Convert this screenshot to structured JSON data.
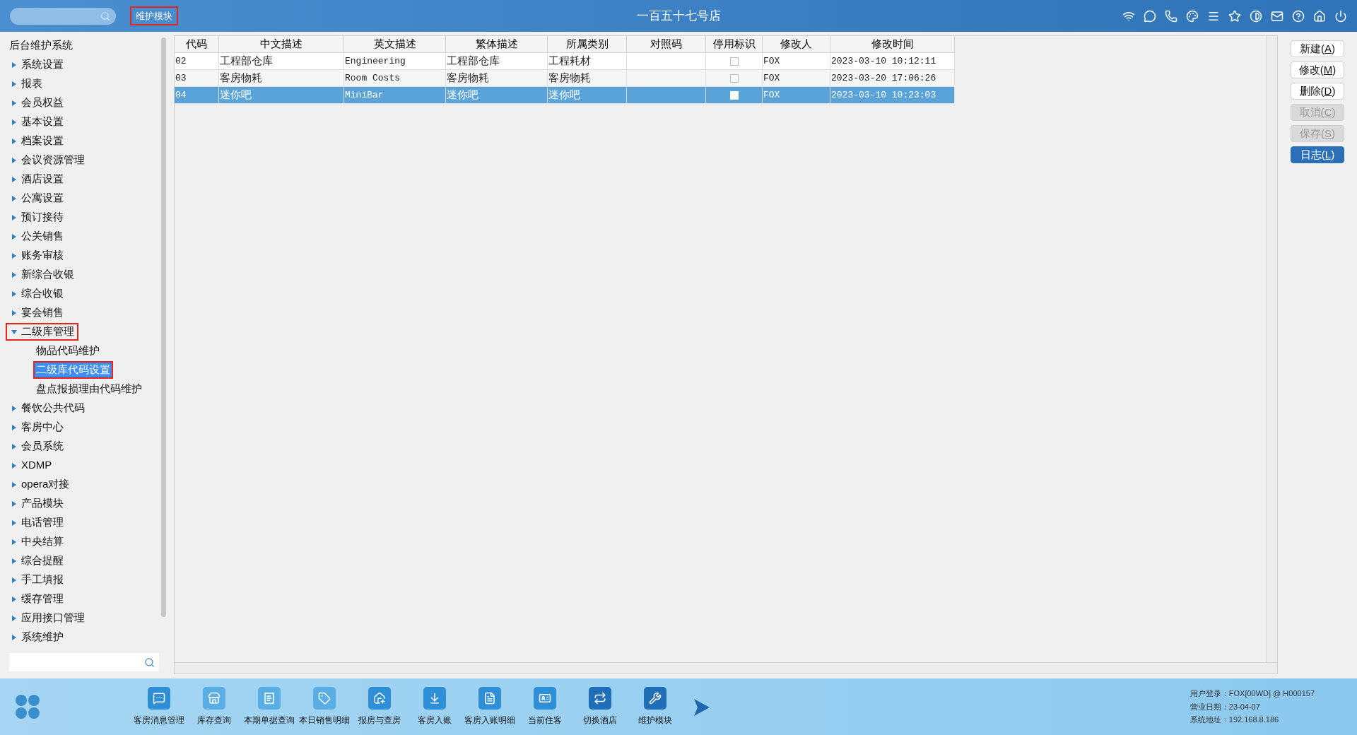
{
  "header": {
    "module_label": "维护模块",
    "module_label_annotated": true,
    "title": "一百五十七号店"
  },
  "sidebar": {
    "root": "后台维护系统",
    "items": [
      {
        "label": "系统设置",
        "expanded": false,
        "annotated": false
      },
      {
        "label": "报表",
        "expanded": false,
        "annotated": false
      },
      {
        "label": "会员权益",
        "expanded": false,
        "annotated": false
      },
      {
        "label": "基本设置",
        "expanded": false,
        "annotated": false
      },
      {
        "label": "档案设置",
        "expanded": false,
        "annotated": false
      },
      {
        "label": "会议资源管理",
        "expanded": false,
        "annotated": false
      },
      {
        "label": "酒店设置",
        "expanded": false,
        "annotated": false
      },
      {
        "label": "公寓设置",
        "expanded": false,
        "annotated": false
      },
      {
        "label": "预订接待",
        "expanded": false,
        "annotated": false
      },
      {
        "label": "公关销售",
        "expanded": false,
        "annotated": false
      },
      {
        "label": "账务审核",
        "expanded": false,
        "annotated": false
      },
      {
        "label": "新综合收银",
        "expanded": false,
        "annotated": false
      },
      {
        "label": "综合收银",
        "expanded": false,
        "annotated": false
      },
      {
        "label": "宴会销售",
        "expanded": false,
        "annotated": false
      },
      {
        "label": "二级库管理",
        "expanded": true,
        "annotated": true,
        "children": [
          {
            "label": "物品代码维护",
            "selected": false,
            "annotated": false
          },
          {
            "label": "二级库代码设置",
            "selected": true,
            "annotated": true
          },
          {
            "label": "盘点报损理由代码维护",
            "selected": false,
            "annotated": false
          }
        ]
      },
      {
        "label": "餐饮公共代码",
        "expanded": false,
        "annotated": false
      },
      {
        "label": "客房中心",
        "expanded": false,
        "annotated": false
      },
      {
        "label": "会员系统",
        "expanded": false,
        "annotated": false
      },
      {
        "label": "XDMP",
        "expanded": false,
        "annotated": false
      },
      {
        "label": "opera对接",
        "expanded": false,
        "annotated": false
      },
      {
        "label": "产品模块",
        "expanded": false,
        "annotated": false
      },
      {
        "label": "电话管理",
        "expanded": false,
        "annotated": false
      },
      {
        "label": "中央结算",
        "expanded": false,
        "annotated": false
      },
      {
        "label": "综合提醒",
        "expanded": false,
        "annotated": false
      },
      {
        "label": "手工填报",
        "expanded": false,
        "annotated": false
      },
      {
        "label": "缓存管理",
        "expanded": false,
        "annotated": false
      },
      {
        "label": "应用接口管理",
        "expanded": false,
        "annotated": false
      },
      {
        "label": "系统维护",
        "expanded": false,
        "annotated": false
      }
    ]
  },
  "table": {
    "columns": [
      "代码",
      "中文描述",
      "英文描述",
      "繁体描述",
      "所属类别",
      "对照码",
      "停用标识",
      "修改人",
      "修改时间"
    ],
    "rows": [
      {
        "code": "02",
        "zh": "工程部仓库",
        "en": "Engineering",
        "tw": "工程部仓库",
        "category": "工程耗材",
        "disabled": false,
        "modifier": "FOX",
        "time": "2023-03-10 10:12:11",
        "selected": false
      },
      {
        "code": "03",
        "zh": "客房物耗",
        "en": "Room Costs",
        "tw": "客房物耗",
        "category": "客房物耗",
        "disabled": false,
        "modifier": "FOX",
        "time": "2023-03-20 17:06:26",
        "selected": false
      },
      {
        "code": "04",
        "zh": "迷你吧",
        "en": "MiniBar",
        "tw": "迷你吧",
        "category": "迷你吧",
        "disabled": false,
        "modifier": "FOX",
        "time": "2023-03-10 10:23:03",
        "selected": true
      }
    ]
  },
  "actions": [
    {
      "label": "新建(",
      "key": "A",
      "after": ")",
      "disabled": false,
      "primary": false
    },
    {
      "label": "修改(",
      "key": "M",
      "after": ")",
      "disabled": false,
      "primary": false
    },
    {
      "label": "删除(",
      "key": "D",
      "after": ")",
      "disabled": false,
      "primary": false
    },
    {
      "label": "取消(",
      "key": "C",
      "after": ")",
      "disabled": true,
      "primary": false
    },
    {
      "label": "保存(",
      "key": "S",
      "after": ")",
      "disabled": true,
      "primary": false
    },
    {
      "label": "日志(",
      "key": "L",
      "after": ")",
      "disabled": false,
      "primary": true
    }
  ],
  "dock": [
    {
      "kind": "chat",
      "label": "客房消息管理"
    },
    {
      "kind": "home",
      "label": "库存查询"
    },
    {
      "kind": "receipt",
      "label": "本期单据查询"
    },
    {
      "kind": "tag",
      "label": "本日销售明细"
    },
    {
      "kind": "search-home",
      "label": "报房与查房"
    },
    {
      "kind": "download-home",
      "label": "客房入账"
    },
    {
      "kind": "doc",
      "label": "客房入账明细"
    },
    {
      "kind": "card",
      "label": "当前住客"
    },
    {
      "kind": "switch",
      "label": "切换酒店"
    },
    {
      "kind": "wrench",
      "label": "维护模块"
    }
  ],
  "status": [
    {
      "label": "用户登录：",
      "value": "FOX[00WD] @ H000157"
    },
    {
      "label": "营业日期：",
      "value": "23-04-07"
    },
    {
      "label": "系统地址：",
      "value": "192.168.8.186"
    }
  ]
}
